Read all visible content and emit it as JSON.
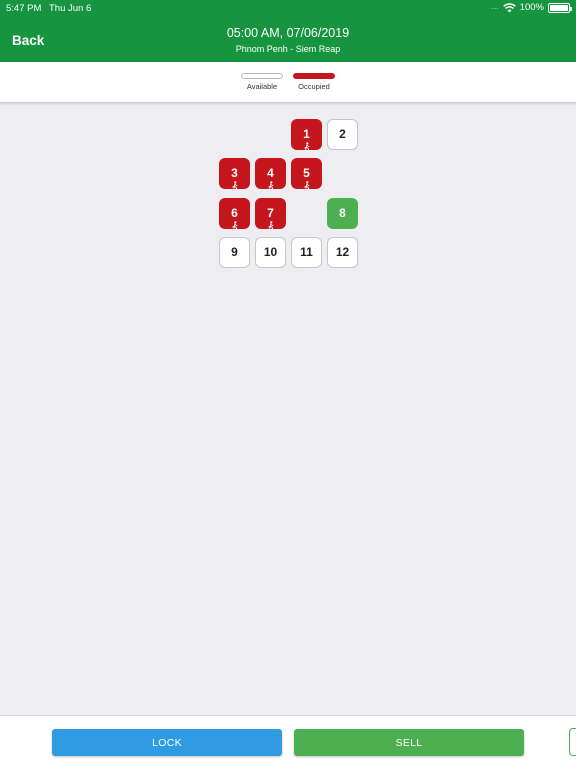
{
  "status_bar": {
    "time": "5:47 PM",
    "date": "Thu Jun 6",
    "signal": "....",
    "battery": "100%",
    "battery_level": 1.0
  },
  "nav": {
    "back_label": "Back",
    "title": "05:00 AM, 07/06/2019",
    "subtitle": "Phnom Penh - Siem Reap"
  },
  "legend": {
    "available_label": "Available",
    "occupied_label": "Occupied"
  },
  "colors": {
    "header": "#16943f",
    "available": "#ffffff",
    "occupied": "#c4161c",
    "selected": "#4caf50",
    "lock": "#2f9be3",
    "sell": "#4caf50"
  },
  "seats": [
    {
      "number": "1",
      "status": "occupied"
    },
    {
      "number": "2",
      "status": "available"
    },
    {
      "number": "3",
      "status": "occupied"
    },
    {
      "number": "4",
      "status": "occupied"
    },
    {
      "number": "5",
      "status": "occupied"
    },
    {
      "number": "6",
      "status": "occupied"
    },
    {
      "number": "7",
      "status": "occupied"
    },
    {
      "number": "8",
      "status": "selected"
    },
    {
      "number": "9",
      "status": "available"
    },
    {
      "number": "10",
      "status": "available"
    },
    {
      "number": "11",
      "status": "available"
    },
    {
      "number": "12",
      "status": "available"
    }
  ],
  "actions": {
    "lock_label": "LOCK",
    "sell_label": "SELL"
  }
}
